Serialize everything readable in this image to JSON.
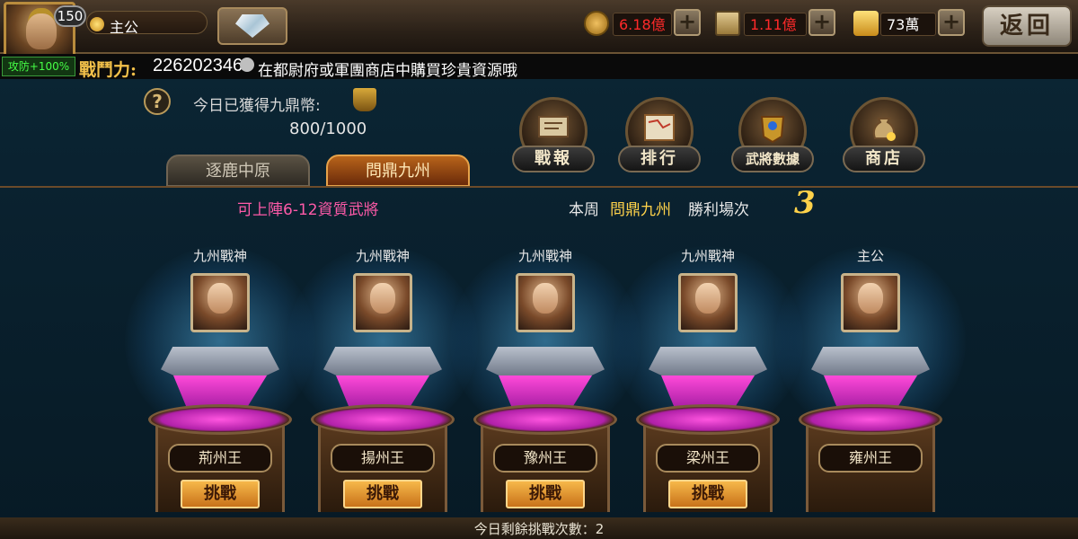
{
  "player": {
    "level": "150",
    "rank_title": "主公",
    "buff": "攻防+100%",
    "power_label": "戰鬥力:",
    "power_value": "226202346"
  },
  "resources": [
    {
      "name": "coin",
      "value": "6.18億",
      "color": "#ff2a2a"
    },
    {
      "name": "scroll",
      "value": "1.11億",
      "color": "#ff2a2a"
    },
    {
      "name": "gold",
      "value": "73萬",
      "color": "#ffffff"
    }
  ],
  "back_label": "返回",
  "marquee": "在都尉府或軍團商店中購買珍貴資源哦",
  "daily": {
    "label": "今日已獲得九鼎幣:",
    "value": "800/1000"
  },
  "tabs": [
    {
      "label": "逐鹿中原",
      "active": false
    },
    {
      "label": "問鼎九州",
      "active": true
    }
  ],
  "menu": [
    {
      "label": "戰報",
      "icon": "scroll-icon"
    },
    {
      "label": "排行",
      "icon": "map-icon"
    },
    {
      "label": "武將數據",
      "icon": "armor-icon"
    },
    {
      "label": "商店",
      "icon": "money-bag-icon"
    }
  ],
  "limit_text": "可上陣6-12資質武將",
  "week": {
    "prefix": "本周",
    "mode": "問鼎九州",
    "suffix": "勝利場次",
    "count": "3"
  },
  "slots": [
    {
      "title": "九州戰神",
      "name": "荊州王",
      "button": "挑戰"
    },
    {
      "title": "九州戰神",
      "name": "揚州王",
      "button": "挑戰"
    },
    {
      "title": "九州戰神",
      "name": "豫州王",
      "button": "挑戰"
    },
    {
      "title": "九州戰神",
      "name": "梁州王",
      "button": "挑戰"
    },
    {
      "title": "主公",
      "name": "雍州王",
      "button": ""
    }
  ],
  "footer": "今日剩餘挑戰次數：2",
  "colors": {
    "accent_gold": "#ffd24a",
    "highlight_pink": "#ff5aa8",
    "crystal": "#ff4ad9"
  }
}
